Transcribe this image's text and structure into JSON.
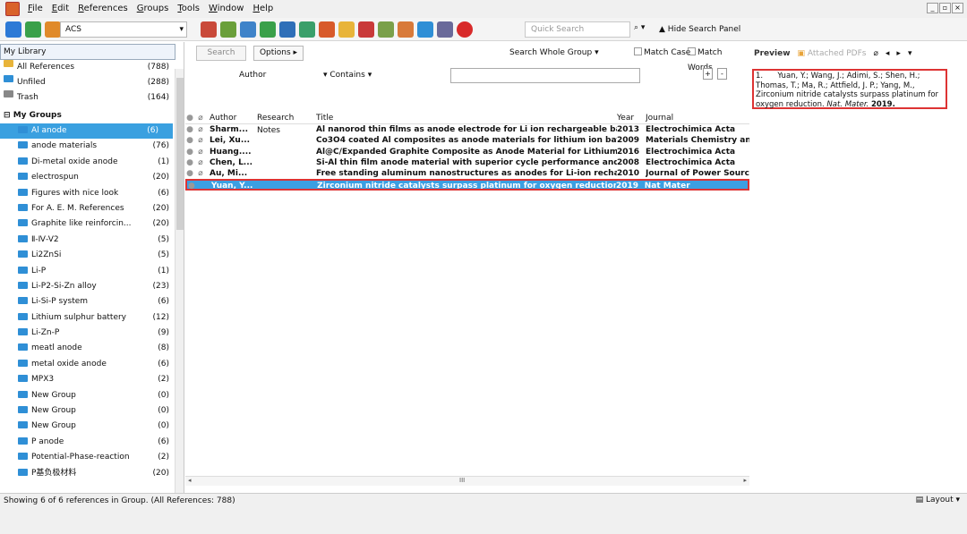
{
  "menu": {
    "items": [
      {
        "label": "File",
        "u": "F",
        "rest": "ile"
      },
      {
        "label": "Edit",
        "u": "E",
        "rest": "dit"
      },
      {
        "label": "References",
        "u": "R",
        "rest": "eferences"
      },
      {
        "label": "Groups",
        "u": "G",
        "rest": "roups"
      },
      {
        "label": "Tools",
        "u": "T",
        "rest": "ools"
      },
      {
        "label": "Window",
        "u": "W",
        "rest": "indow"
      },
      {
        "label": "Help",
        "u": "H",
        "rest": "elp"
      }
    ]
  },
  "toolbar": {
    "style_value": "ACS",
    "quick_search_placeholder": "Quick Search",
    "hide_search_panel": "Hide Search Panel"
  },
  "library": {
    "header": "My Library",
    "items": [
      {
        "label": "All References",
        "count": "(788)"
      },
      {
        "label": "Unfiled",
        "count": "(288)"
      },
      {
        "label": "Trash",
        "count": "(164)"
      }
    ],
    "my_groups_label": "My Groups",
    "groups": [
      {
        "label": "Al anode",
        "count": "(6)"
      },
      {
        "label": "anode materials",
        "count": "(76)"
      },
      {
        "label": "Di-metal oxide anode",
        "count": "(1)"
      },
      {
        "label": "electrospun",
        "count": "(20)"
      },
      {
        "label": "Figures with nice look",
        "count": "(6)"
      },
      {
        "label": "For A. E. M. References",
        "count": "(20)"
      },
      {
        "label": "Graphite like reinforcin...",
        "count": "(20)"
      },
      {
        "label": "Ⅱ-Ⅳ-V2",
        "count": "(5)"
      },
      {
        "label": "Li2ZnSi",
        "count": "(5)"
      },
      {
        "label": "Li-P",
        "count": "(1)"
      },
      {
        "label": "Li-P2-Si-Zn alloy",
        "count": "(23)"
      },
      {
        "label": "Li-Si-P system",
        "count": "(6)"
      },
      {
        "label": "Lithium sulphur battery",
        "count": "(12)"
      },
      {
        "label": "Li-Zn-P",
        "count": "(9)"
      },
      {
        "label": "meatl anode",
        "count": "(8)"
      },
      {
        "label": "metal oxide anode",
        "count": "(6)"
      },
      {
        "label": "MPX3",
        "count": "(2)"
      },
      {
        "label": "New Group",
        "count": "(0)"
      },
      {
        "label": "New Group",
        "count": "(0)"
      },
      {
        "label": "New Group",
        "count": "(0)"
      },
      {
        "label": "P anode",
        "count": "(6)"
      },
      {
        "label": "Potential-Phase-reaction",
        "count": "(2)"
      },
      {
        "label": "P基负极材料",
        "count": "(20)"
      }
    ]
  },
  "search": {
    "search_button": "Search",
    "options_button": "Options ▸",
    "scope": "Search Whole Group",
    "match_case": "Match Case",
    "match_words": "Match Words",
    "field": "Author",
    "operator": "Contains",
    "plus": "+",
    "minus": "-"
  },
  "table": {
    "headers": {
      "author": "Author",
      "notes": "Research Notes",
      "title": "Title",
      "year": "Year",
      "journal": "Journal"
    },
    "rows": [
      {
        "author": "Sharm...",
        "title": "Al nanorod thin films as anode electrode for Li ion rechargeable batteries",
        "year": "2013",
        "journal": "Electrochimica Acta"
      },
      {
        "author": "Lei, Xu...",
        "title": "Co3O4 coated Al composites as anode materials for lithium ion batteries",
        "year": "2009",
        "journal": "Materials Chemistry and"
      },
      {
        "author": "Huang....",
        "title": "Al@C/Expanded Graphite Composite as Anode Material for Lithium Ion Bat...",
        "year": "2016",
        "journal": "Electrochimica Acta"
      },
      {
        "author": "Chen, L...",
        "title": "Si-Al thin film anode material with superior cycle performance and rate ca...",
        "year": "2008",
        "journal": "Electrochimica Acta"
      },
      {
        "author": "Au, Mi...",
        "title": "Free standing aluminum nanostructures as anodes for Li-ion rechargeable b...",
        "year": "2010",
        "journal": "Journal of Power Source"
      },
      {
        "author": "Yuan, Y...",
        "title": "Zirconium nitride catalysts surpass platinum for oxygen reduction",
        "year": "2019",
        "journal": "Nat Mater"
      }
    ],
    "hscroll_mark": "III"
  },
  "preview": {
    "tab_preview": "Preview",
    "tab_attached": "Attached PDFs",
    "number": "1.",
    "authors": "Yuan, Y.; Wang, J.; Adimi, S.; Shen, H.; Thomas, T.; Ma, R.; Attfield, J. P.; Yang, M.,",
    "title": "Zirconium nitride catalysts surpass platinum for oxygen reduction.",
    "journal": "Nat. Mater.",
    "year": "2019."
  },
  "status": {
    "text": "Showing 6 of 6 references in Group. (All References: 788)",
    "layout": "Layout"
  },
  "colors": {
    "accent": "#3b9fe2",
    "highlight_border": "#d33333"
  }
}
